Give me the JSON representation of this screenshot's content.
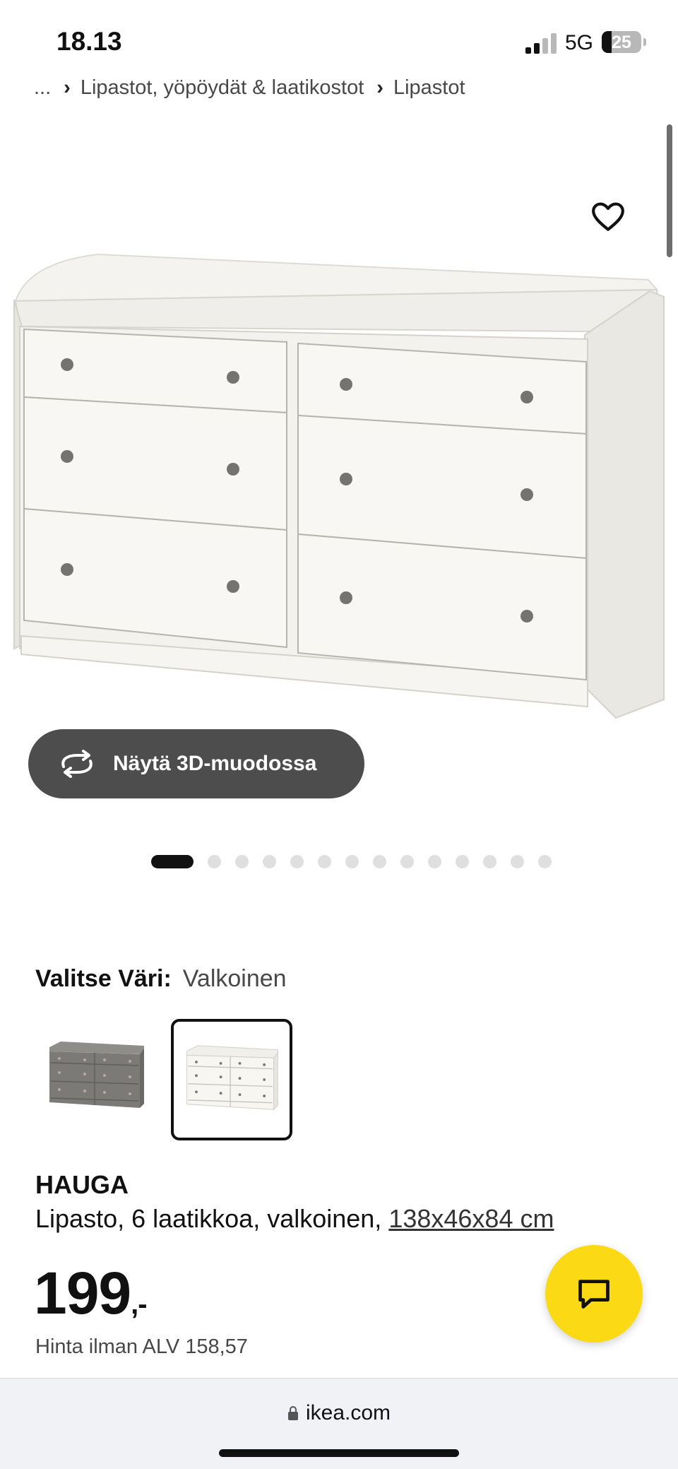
{
  "status_bar": {
    "time": "18.13",
    "network": "5G",
    "battery_level": "25",
    "battery_fraction": 0.25
  },
  "breadcrumb": {
    "ellipsis": "...",
    "items": [
      "Lipastot, yöpöydät & laatikostot",
      "Lipastot"
    ]
  },
  "gallery": {
    "view_3d_label": "Näytä 3D-muodossa",
    "image_count": 14,
    "active_index": 0,
    "favorite_icon": "heart-icon"
  },
  "color_choice": {
    "label": "Valitse Väri:",
    "selected_value": "Valkoinen",
    "swatches": [
      {
        "name": "grey",
        "color": "#7d7c7a",
        "selected": false
      },
      {
        "name": "white",
        "color": "#f4f2ec",
        "selected": true
      }
    ]
  },
  "product": {
    "name": "HAUGA",
    "description": "Lipasto, 6 laatikkoa, valkoinen,",
    "size": "138x46x84 cm",
    "price": "199",
    "price_suffix": ",-",
    "price_ex_vat": "Hinta ilman ALV 158,57"
  },
  "chat": {
    "icon": "chat-icon",
    "color": "#fbd914"
  },
  "browser": {
    "url": "ikea.com"
  }
}
